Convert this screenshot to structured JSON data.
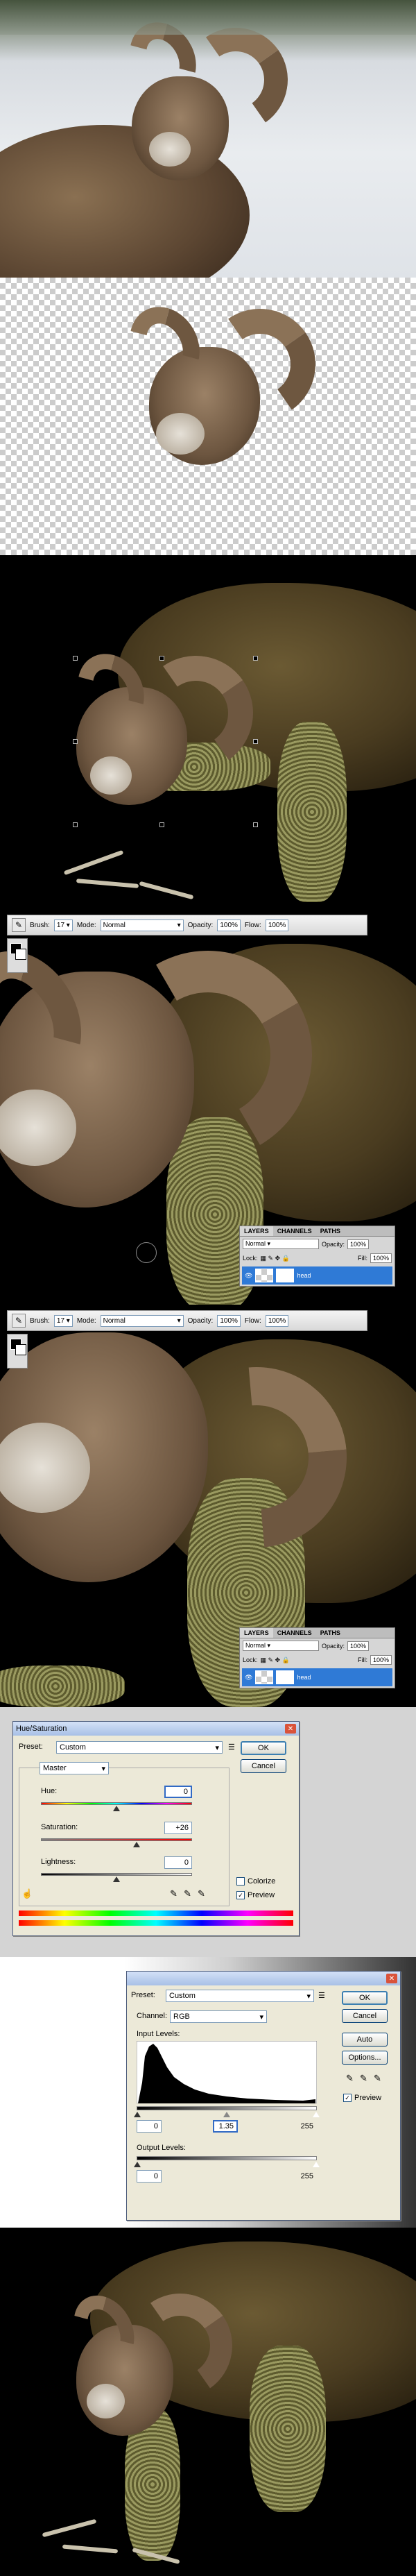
{
  "toolbar": {
    "brush_label": "Brush:",
    "brush_size": "17",
    "mode_label": "Mode:",
    "mode_value": "Normal",
    "opacity_label": "Opacity:",
    "opacity_value": "100%",
    "flow_label": "Flow:",
    "flow_value": "100%"
  },
  "layers_panel": {
    "tabs": [
      "LAYERS",
      "CHANNELS",
      "PATHS"
    ],
    "blend_mode": "Normal",
    "opacity_label": "Opacity:",
    "opacity_value": "100%",
    "lock_label": "Lock:",
    "fill_label": "Fill:",
    "fill_value": "100%",
    "layer_name": "head"
  },
  "hue_saturation": {
    "title": "Hue/Saturation",
    "preset_label": "Preset:",
    "preset_value": "Custom",
    "edit_value": "Master",
    "hue_label": "Hue:",
    "hue_value": "0",
    "saturation_label": "Saturation:",
    "saturation_value": "+26",
    "lightness_label": "Lightness:",
    "lightness_value": "0",
    "colorize_label": "Colorize",
    "preview_label": "Preview",
    "ok_label": "OK",
    "cancel_label": "Cancel"
  },
  "levels": {
    "preset_label": "Preset:",
    "preset_value": "Custom",
    "channel_label": "Channel:",
    "channel_value": "RGB",
    "input_levels_label": "Input Levels:",
    "input_black": "0",
    "input_gray": "1.35",
    "input_white": "255",
    "output_levels_label": "Output Levels:",
    "output_black": "0",
    "output_white": "255",
    "ok_label": "OK",
    "cancel_label": "Cancel",
    "auto_label": "Auto",
    "options_label": "Options...",
    "preview_label": "Preview"
  }
}
